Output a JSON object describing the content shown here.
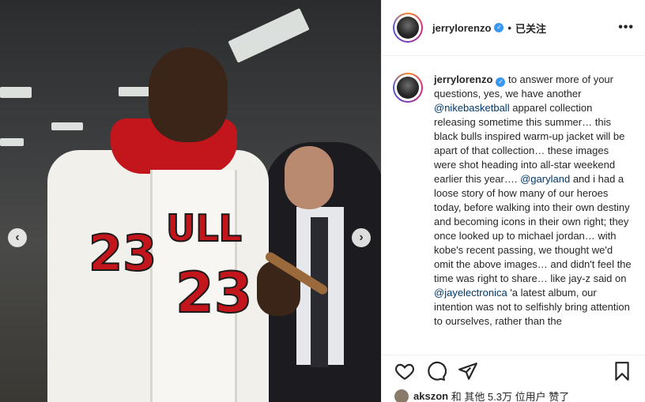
{
  "post": {
    "username": "jerrylorenzo",
    "follow_status": "已关注",
    "separator": "•",
    "caption": {
      "p1": "to answer more of your questions, yes, we have another",
      "m1": "@nikebasketball",
      "p2": "apparel collection releasing sometime this summer… this black bulls inspired warm-up jacket will be apart of that collection… these images were shot heading into all-star weekend earlier this year….",
      "m2": "@garyland",
      "p3": "and i had a loose story of how many of our heroes today, before walking into their own destiny and becoming icons in their own right; they once looked up to michael jordan… with kobe's recent passing, we thought we'd omit the above images… and didn't feel the time was right to share… like jay-z said on",
      "m3": "@jayelectronica",
      "p4": "'a latest album, our intention was not to selfishly bring attention to ourselves, rather than the"
    },
    "likes": {
      "user": "akszon",
      "text": "和 其他 5.3万 位用户 赞了"
    }
  },
  "photo": {
    "jersey_text_1": "ULL",
    "jersey_number": "23",
    "jacket_number": "23"
  },
  "carousel": {
    "prev": "‹",
    "next": "›"
  },
  "icons": [
    "heart-icon",
    "comment-icon",
    "share-icon",
    "bookmark-icon",
    "more-icon",
    "verified-icon"
  ],
  "colors": {
    "accent": "#3897f0",
    "mention": "#00376b",
    "jersey_red": "#c3161c"
  }
}
